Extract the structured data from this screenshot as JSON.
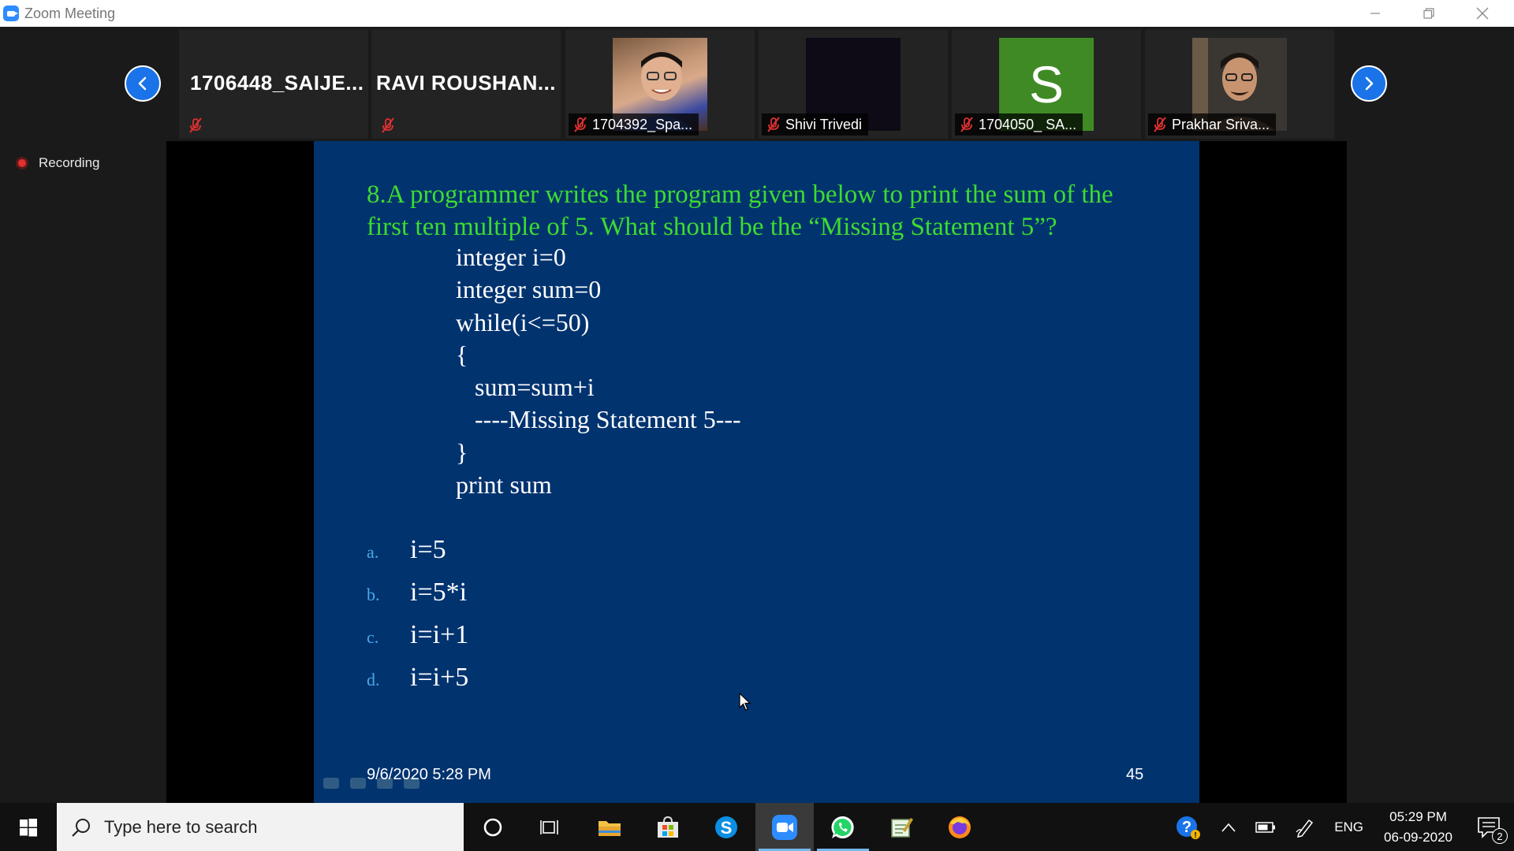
{
  "window": {
    "title": "Zoom Meeting"
  },
  "participants": [
    {
      "display": "text",
      "name": "1706448_SAIJE...",
      "muted": true
    },
    {
      "display": "text",
      "name": "RAVI  ROUSHAN...",
      "muted": true
    },
    {
      "display": "photo",
      "name": "1704392_Spa...",
      "muted": true
    },
    {
      "display": "dark",
      "name": "Shivi Trivedi",
      "muted": true
    },
    {
      "display": "initial",
      "initial": "S",
      "name": "1704050_ SA...",
      "muted": true
    },
    {
      "display": "photo",
      "name": "Prakhar Sriva...",
      "muted": true
    }
  ],
  "recording": {
    "label": "Recording"
  },
  "slide": {
    "question_line1": "8.A programmer writes the program given below to print the sum of the",
    "question_line2": "first ten multiple of 5. What should be the “Missing Statement 5”?",
    "code": [
      "integer i=0",
      "integer sum=0",
      "while(i<=50)",
      "{",
      "   sum=sum+i",
      "   ----Missing Statement 5---",
      "}",
      "print sum"
    ],
    "options": [
      {
        "letter": "a.",
        "value": "i=5"
      },
      {
        "letter": "b.",
        "value": "i=5*i"
      },
      {
        "letter": "c.",
        "value": "i=i+1"
      },
      {
        "letter": "d.",
        "value": "i=i+5"
      }
    ],
    "datetime": "9/6/2020 5:28 PM",
    "page_number": "45"
  },
  "taskbar": {
    "search_placeholder": "Type here to search",
    "apps": [
      "cortana-icon",
      "task-view-icon",
      "file-explorer-icon",
      "store-icon",
      "skype-icon",
      "zoom-icon",
      "whatsapp-icon",
      "notepad-icon",
      "firefox-icon"
    ],
    "active_app": "zoom-icon",
    "language": "ENG",
    "time": "05:29 PM",
    "date": "06-09-2020",
    "notification_count": "2"
  },
  "colors": {
    "slide_background": "#01336f",
    "question_text": "#3ddc2f",
    "zoom_blue": "#2d8cff",
    "nav_button": "#1a73e8"
  }
}
